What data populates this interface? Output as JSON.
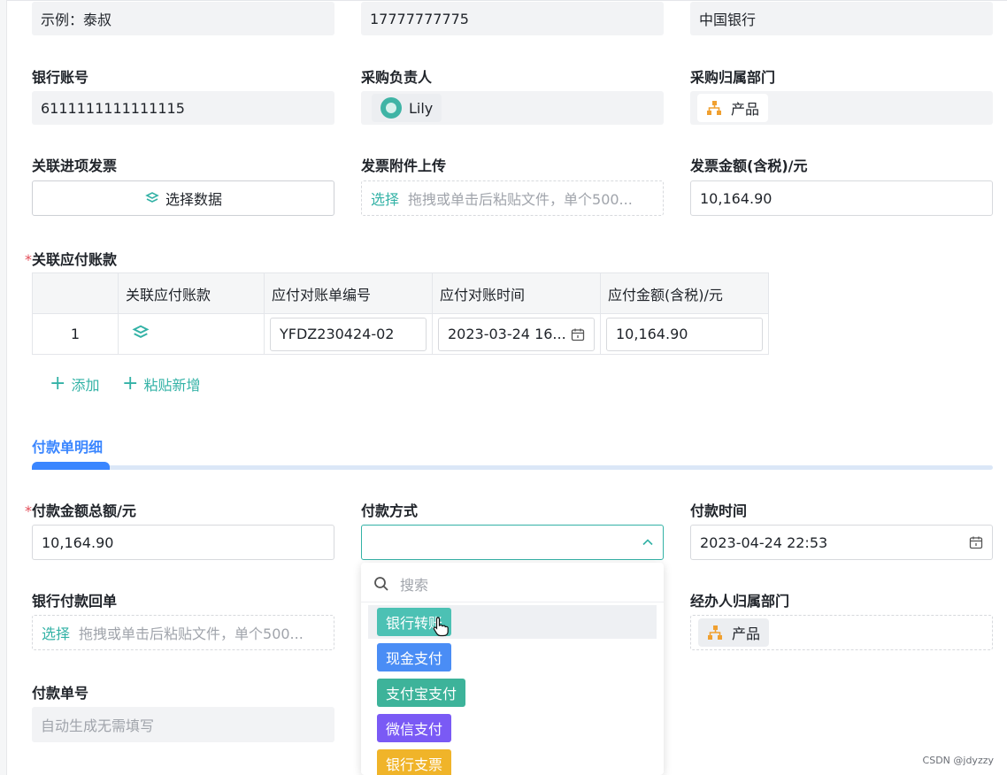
{
  "top_row": {
    "contact": "示例：泰叔",
    "phone": "17777777775",
    "bank": "中国银行"
  },
  "labels": {
    "bank_account": "银行账号",
    "purchase_owner": "采购负责人",
    "purchase_dept": "采购归属部门",
    "linked_invoice": "关联进项发票",
    "invoice_attachment": "发票附件上传",
    "invoice_amount": "发票金额(含税)/元",
    "linked_payable": "关联应付账款",
    "pay_total": "付款金额总额/元",
    "pay_method": "付款方式",
    "pay_time": "付款时间",
    "bank_receipt": "银行付款回单",
    "handler_dept": "经办人归属部门",
    "pay_no": "付款单号"
  },
  "values": {
    "bank_account": "6111111111111115",
    "purchase_owner": "Lily",
    "purchase_dept": "产品",
    "select_data": "选择数据",
    "upload_select": "选择",
    "upload_hint": "拖拽或单击后粘贴文件，单个500...",
    "invoice_amount": "10,164.90",
    "pay_total": "10,164.90",
    "pay_time": "2023-04-24 22:53",
    "handler_dept": "产品",
    "pay_no_placeholder": "自动生成无需填写",
    "required_mark": "*"
  },
  "table": {
    "headers": [
      "",
      "关联应付账款",
      "应付对账单编号",
      "应付对账时间",
      "应付金额(含税)/元"
    ],
    "rows": [
      {
        "index": "1",
        "bill_no": "YFDZ230424-02",
        "date": "2023-03-24 16...",
        "amount": "10,164.90"
      }
    ],
    "add": "添加",
    "paste_add": "粘贴新增"
  },
  "section": {
    "title": "付款单明细"
  },
  "dropdown": {
    "search_placeholder": "搜索",
    "options": [
      {
        "label": "银行转账",
        "color": "#4cc1b4"
      },
      {
        "label": "现金支付",
        "color": "#4a8df5"
      },
      {
        "label": "支付宝支付",
        "color": "#3db39a"
      },
      {
        "label": "微信支付",
        "color": "#7a5af5"
      },
      {
        "label": "银行支票",
        "color": "#f0b429"
      }
    ]
  },
  "watermark": "CSDN @jdyzzy",
  "colors": {
    "accent": "#33b2a6",
    "blue": "#3a86ff",
    "required": "#e34d59"
  }
}
